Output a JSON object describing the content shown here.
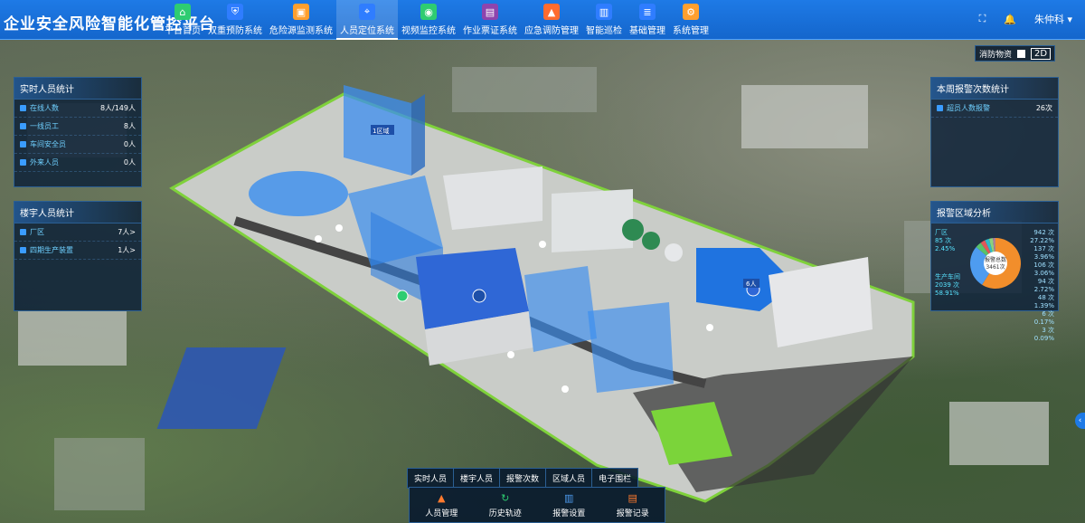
{
  "app": {
    "title": "企业安全风险智能化管控平台"
  },
  "nav": [
    {
      "label": "平台首页",
      "icon": "home-icon",
      "color": "#2ecc71"
    },
    {
      "label": "双重预防系统",
      "icon": "shield-icon",
      "color": "#2f7dff"
    },
    {
      "label": "危险源监测系统",
      "icon": "monitor-icon",
      "color": "#ff9f2e"
    },
    {
      "label": "人员定位系统",
      "icon": "location-icon",
      "color": "#2f7dff"
    },
    {
      "label": "视频监控系统",
      "icon": "camera-icon",
      "color": "#2ecc71"
    },
    {
      "label": "作业票证系统",
      "icon": "ticket-icon",
      "color": "#8e44ad"
    },
    {
      "label": "应急调防管理",
      "icon": "warning-icon",
      "color": "#ff6b2e"
    },
    {
      "label": "智能巡检",
      "icon": "patrol-icon",
      "color": "#2f7dff"
    },
    {
      "label": "基础管理",
      "icon": "database-icon",
      "color": "#2f7dff"
    },
    {
      "label": "系统管理",
      "icon": "settings-icon",
      "color": "#ff9f2e"
    }
  ],
  "active_nav": "人员定位系统",
  "user": {
    "name": "朱仲科"
  },
  "realtime_panel": {
    "title": "实时人员统计",
    "rows": [
      {
        "label": "在线人数",
        "value": "8人/149人"
      },
      {
        "label": "一线员工",
        "value": "8人"
      },
      {
        "label": "车间安全员",
        "value": "0人"
      },
      {
        "label": "外来人员",
        "value": "0人"
      }
    ]
  },
  "building_panel": {
    "title": "楼宇人员统计",
    "rows": [
      {
        "label": "厂区",
        "value": "7人>"
      },
      {
        "label": "四期生产装置",
        "value": "1人>"
      }
    ]
  },
  "weekly_panel": {
    "title": "本周报警次数统计",
    "rows": [
      {
        "label": "超员人数报警",
        "value": "26次"
      }
    ]
  },
  "area_panel": {
    "title": "报警区域分析",
    "center_label": "报警总数",
    "center_value": "3461次",
    "left_labels": [
      {
        "name": "厂区",
        "value": "85 次",
        "pct": "2.45%"
      },
      {
        "name": "生产车间",
        "value": "2039 次",
        "pct": "58.91%"
      }
    ],
    "right_labels": [
      "942 次",
      "27.22%",
      "137 次",
      "3.96%",
      "106 次",
      "3.06%",
      "94 次",
      "2.72%",
      "48 次",
      "1.39%",
      "6 次",
      "0.17%",
      "3 次",
      "0.09%"
    ],
    "segments": [
      {
        "value": 2039,
        "color": "#f28e2b"
      },
      {
        "value": 942,
        "color": "#4e9cf0"
      },
      {
        "value": 137,
        "color": "#59c26b"
      },
      {
        "value": 106,
        "color": "#e15759"
      },
      {
        "value": 94,
        "color": "#2fbac7"
      },
      {
        "value": 85,
        "color": "#8cd17d"
      },
      {
        "value": 48,
        "color": "#b07aa1"
      },
      {
        "value": 6,
        "color": "#edc948"
      },
      {
        "value": 3,
        "color": "#ff9da7"
      }
    ]
  },
  "view_toggle": {
    "label": "消防物资",
    "mode": "2D"
  },
  "bottom_tabs": [
    "实时人员",
    "楼宇人员",
    "报警次数",
    "区域人员",
    "电子围栏"
  ],
  "bottom_actions": [
    {
      "label": "人员管理",
      "icon": "person-icon"
    },
    {
      "label": "历史轨迹",
      "icon": "history-icon"
    },
    {
      "label": "报警设置",
      "icon": "alarm-settings-icon"
    },
    {
      "label": "报警记录",
      "icon": "alarm-record-icon"
    }
  ],
  "map_labels": {
    "building_1": "1区域",
    "people_marker": "6人"
  }
}
